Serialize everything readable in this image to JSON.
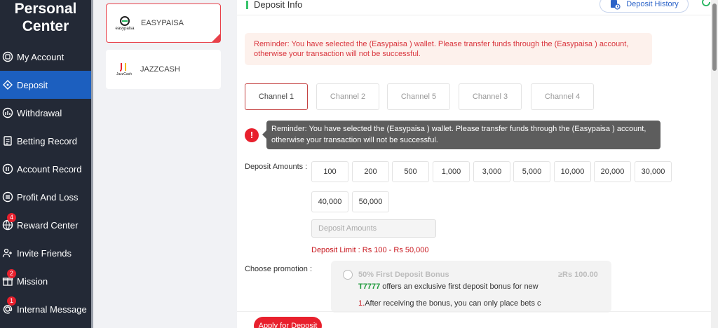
{
  "sidebar": {
    "title_line1": "Personal",
    "title_line2": "Center",
    "items": [
      {
        "label": "My Account",
        "icon": "account-circle-icon"
      },
      {
        "label": "Deposit",
        "icon": "deposit-tag-icon",
        "active": true
      },
      {
        "label": "Withdrawal",
        "icon": "withdrawal-chart-icon"
      },
      {
        "label": "Betting Record",
        "icon": "betting-record-icon"
      },
      {
        "label": "Account Record",
        "icon": "account-record-icon"
      },
      {
        "label": "Profit And Loss",
        "icon": "profit-loss-icon"
      },
      {
        "label": "Reward Center",
        "icon": "reward-globe-icon",
        "badge": "4"
      },
      {
        "label": "Invite Friends",
        "icon": "invite-friends-icon"
      },
      {
        "label": "Mission",
        "icon": "gift-icon",
        "badge": "2"
      },
      {
        "label": "Internal Message",
        "icon": "at-sign-icon",
        "badge": "1"
      }
    ]
  },
  "wallets": [
    {
      "name": "EASYPAISA",
      "logo_text": "easypaisa",
      "selected": true
    },
    {
      "name": "JAZZCASH",
      "logo_text": "JazzCash",
      "selected": false
    }
  ],
  "main": {
    "title": "Deposit Info",
    "history_label": "Deposit History",
    "reminder": "Reminder: You have selected the (Easypaisa ) wallet. Please transfer funds through the (Easypaisa ) account, otherwise your transaction will not be successful.",
    "tooltip": "Reminder: You have selected the (Easypaisa ) wallet. Please transfer funds through the (Easypaisa ) account, otherwise your transaction will not be successful.",
    "channels": [
      "Channel 1",
      "Channel 2",
      "Channel 5",
      "Channel 3",
      "Channel 4"
    ],
    "active_channel": "Channel 1",
    "amounts_label": "Deposit Amounts :",
    "amounts_row1": [
      "100",
      "200",
      "500",
      "1,000",
      "3,000",
      "5,000",
      "10,000",
      "20,000",
      "30,000"
    ],
    "amounts_row2": [
      "40,000",
      "50,000"
    ],
    "amount_placeholder": "Deposit Amounts",
    "limit_text": "Deposit Limit :  Rs  100  -  Rs  50,000",
    "promotion_label": "Choose promotion :",
    "promotion": {
      "title": "50% First Deposit Bonus",
      "min": "≥Rs  100.00",
      "brand": "T7777",
      "desc": " offers an exclusive first deposit bonus for new",
      "rule_num": "1.",
      "rule_text": "After receiving the bonus, you can only place bets c"
    },
    "apply_label": "Apply for Deposit"
  },
  "colors": {
    "sidebar_bg": "#232936",
    "active_blue": "#1c5fbf",
    "accent_red": "#e8202d",
    "brand_green": "#1f9a3c"
  }
}
